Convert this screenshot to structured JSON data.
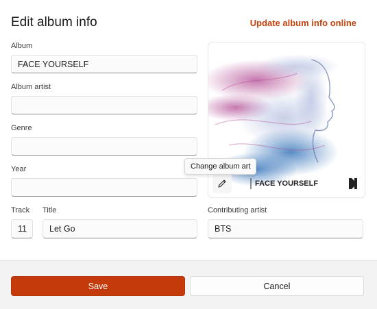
{
  "dialog": {
    "title": "Edit album info",
    "online_link": "Update album info online"
  },
  "fields": {
    "album": {
      "label": "Album",
      "value": "FACE YOURSELF"
    },
    "album_artist": {
      "label": "Album artist",
      "value": ""
    },
    "genre": {
      "label": "Genre",
      "value": ""
    },
    "year": {
      "label": "Year",
      "value": ""
    },
    "track": {
      "label": "Track",
      "value": "11"
    },
    "title": {
      "label": "Title",
      "value": "Let Go"
    },
    "contributing_artist": {
      "label": "Contributing artist",
      "value": "BTS"
    }
  },
  "album_art": {
    "cover_title": "FACE YOURSELF",
    "tooltip": "Change album art",
    "edit_icon": "pencil-icon"
  },
  "footer": {
    "save_label": "Save",
    "cancel_label": "Cancel"
  },
  "colors": {
    "accent": "#c53a0b",
    "link": "#c4420c"
  }
}
